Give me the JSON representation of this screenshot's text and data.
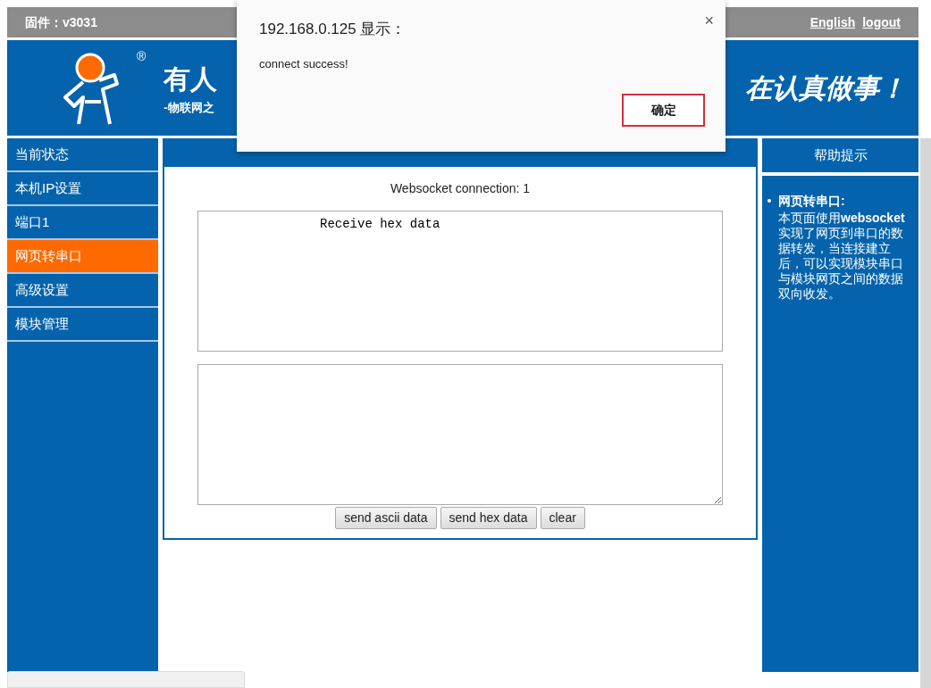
{
  "top_bar": {
    "firmware": "固件：v3031",
    "links": [
      "English",
      "logout"
    ]
  },
  "header": {
    "logo_mark": "®",
    "title": "有人",
    "subtitle": "-物联网之",
    "slogan": "在认真做事！"
  },
  "sidebar": {
    "items": [
      {
        "label": "当前状态",
        "selected": false
      },
      {
        "label": "本机IP设置",
        "selected": false
      },
      {
        "label": "端口1",
        "selected": false
      },
      {
        "label": "网页转串口",
        "selected": true
      },
      {
        "label": "高级设置",
        "selected": false
      },
      {
        "label": "模块管理",
        "selected": false
      }
    ]
  },
  "main": {
    "status": "Websocket connection: 1",
    "receive_box": {
      "value": "Receive hex data"
    },
    "buttons": [
      "send ascii data",
      "send hex data",
      "clear"
    ]
  },
  "help": {
    "title": "帮助提示",
    "heading": "网页转串口:",
    "body": "本页面使用**websocket**实现了网页到串口的数据转发，当连接建立后，可以实现模块串口与模块网页之间的数据双向收发。"
  },
  "dialog": {
    "title": "192.168.0.125 显示：",
    "message": "connect success!",
    "close": "×",
    "ok": "确定"
  }
}
